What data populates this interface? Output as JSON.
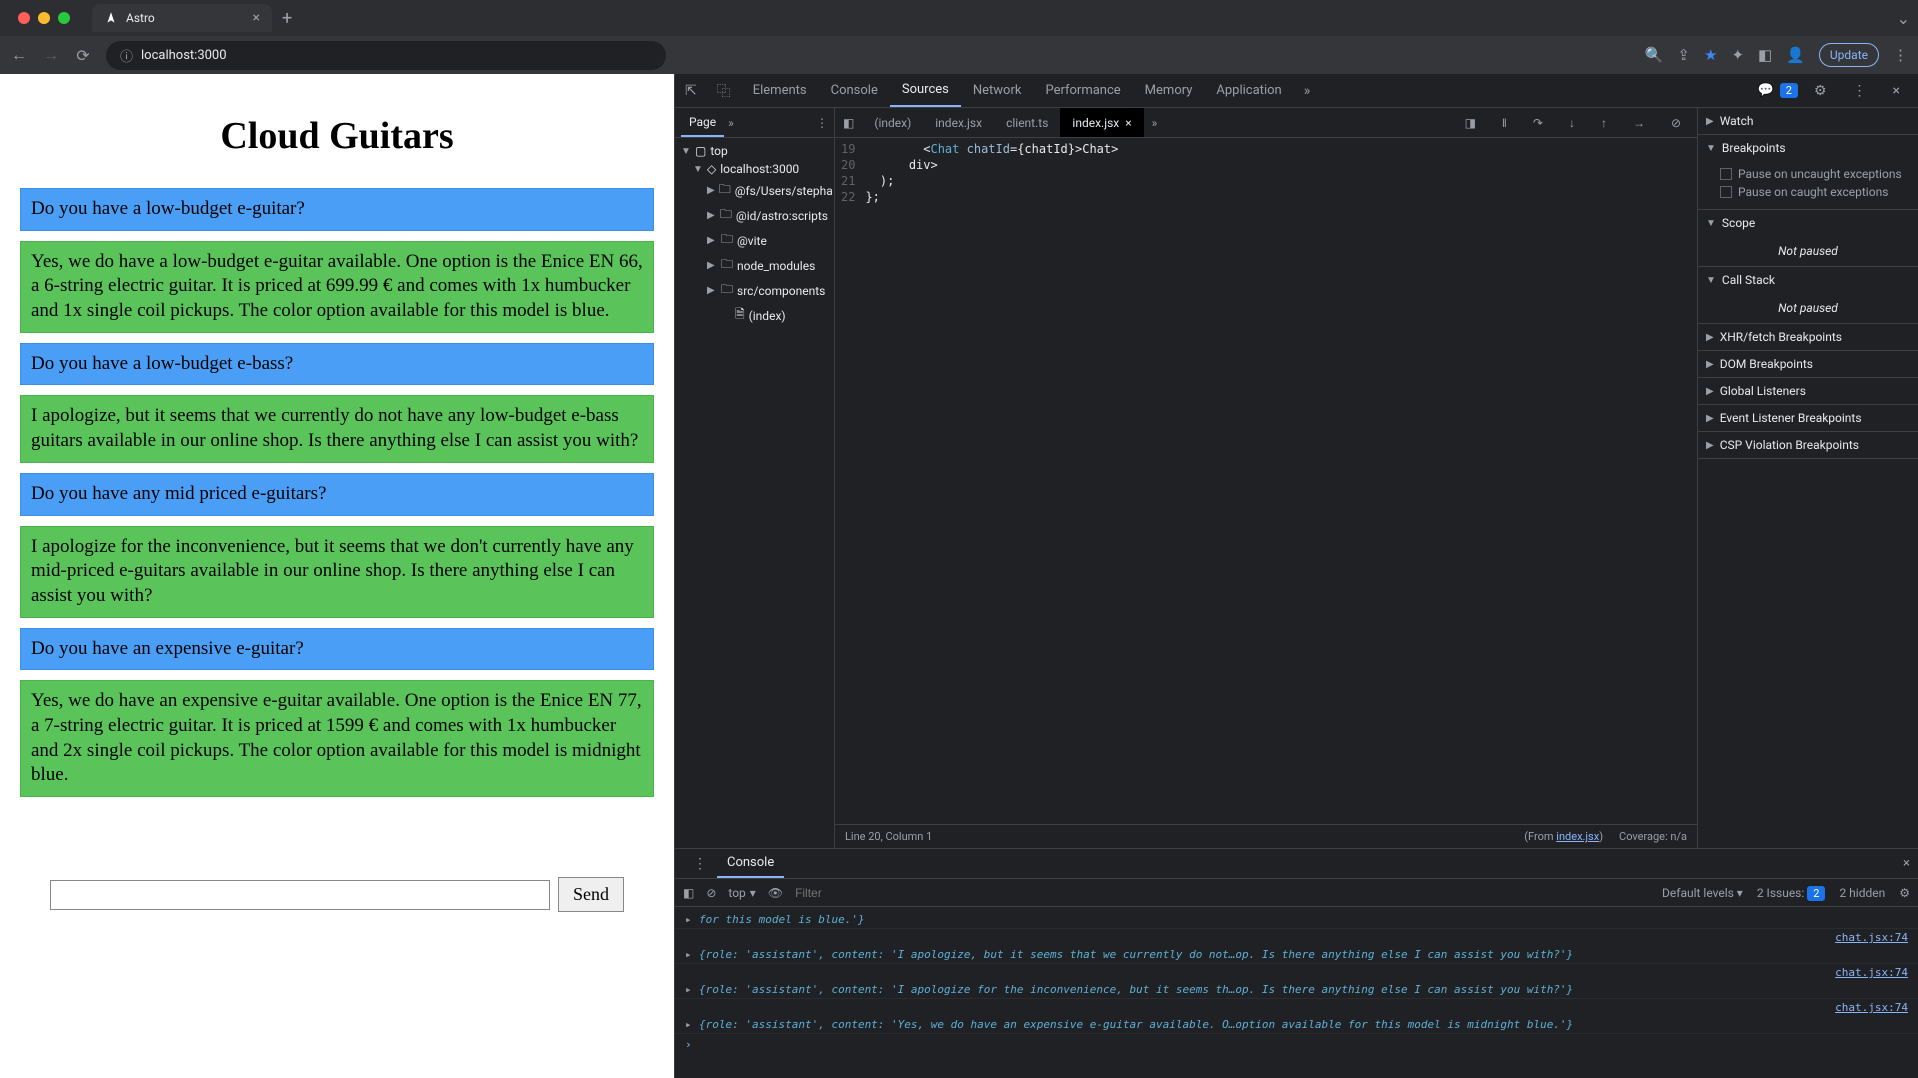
{
  "browser": {
    "tab_title": "Astro",
    "url": "localhost:3000",
    "update_label": "Update"
  },
  "page": {
    "title": "Cloud Guitars",
    "messages": [
      {
        "role": "user",
        "text": "Do you have a low-budget e-guitar?"
      },
      {
        "role": "assistant",
        "text": "Yes, we do have a low-budget e-guitar available. One option is the Enice EN 66, a 6-string electric guitar. It is priced at 699.99 € and comes with 1x humbucker and 1x single coil pickups. The color option available for this model is blue."
      },
      {
        "role": "user",
        "text": "Do you have a low-budget e-bass?"
      },
      {
        "role": "assistant",
        "text": "I apologize, but it seems that we currently do not have any low-budget e-bass guitars available in our online shop. Is there anything else I can assist you with?"
      },
      {
        "role": "user",
        "text": "Do you have any mid priced e-guitars?"
      },
      {
        "role": "assistant",
        "text": "I apologize for the inconvenience, but it seems that we don't currently have any mid-priced e-guitars available in our online shop. Is there anything else I can assist you with?"
      },
      {
        "role": "user",
        "text": "Do you have an expensive e-guitar?"
      },
      {
        "role": "assistant",
        "text": "Yes, we do have an expensive e-guitar available. One option is the Enice EN 77, a 7-string electric guitar. It is priced at 1599 € and comes with 1x humbucker and 2x single coil pickups. The color option available for this model is midnight blue."
      }
    ],
    "send_label": "Send"
  },
  "devtools": {
    "tabs": [
      "Elements",
      "Console",
      "Sources",
      "Network",
      "Performance",
      "Memory",
      "Application"
    ],
    "active_tab": "Sources",
    "issues_count": "2",
    "sources": {
      "nav_tab": "Page",
      "tree": {
        "top": "top",
        "host": "localhost:3000",
        "folders": [
          "@fs/Users/stepha",
          "@id/astro:scripts",
          "@vite",
          "node_modules",
          "src/components"
        ],
        "file": "(index)"
      },
      "open_files": [
        "(index)",
        "index.jsx",
        "client.ts",
        "index.jsx"
      ],
      "active_file_index": 3,
      "code_lines": [
        {
          "n": "19",
          "html": "        <<span class='tok-tag'>Chat</span> <span class='tok-attr'>chatId</span>={chatId}></<span class='tok-tag'>Chat</span>>"
        },
        {
          "n": "20",
          "html": "      </<span class='tok-tag'>div</span>>"
        },
        {
          "n": "21",
          "html": "  );"
        },
        {
          "n": "22",
          "html": "};"
        }
      ],
      "status_left": "Line 20, Column 1",
      "status_from": "(From ",
      "status_from_link": "index.jsx",
      "status_from_suffix": ")",
      "status_coverage": "Coverage: n/a"
    },
    "debugger": {
      "watch": "Watch",
      "breakpoints": "Breakpoints",
      "pause_uncaught": "Pause on uncaught exceptions",
      "pause_caught": "Pause on caught exceptions",
      "scope": "Scope",
      "call_stack": "Call Stack",
      "not_paused": "Not paused",
      "xhr_bp": "XHR/fetch Breakpoints",
      "dom_bp": "DOM Breakpoints",
      "global_listeners": "Global Listeners",
      "event_bp": "Event Listener Breakpoints",
      "csp_bp": "CSP Violation Breakpoints"
    },
    "console": {
      "tab_label": "Console",
      "context": "top",
      "filter_placeholder": "Filter",
      "levels": "Default levels",
      "issues_label": "2 Issues:",
      "issues_badge": "2",
      "hidden": "2 hidden",
      "logs": [
        {
          "text": "for this model is blue.'}",
          "src": ""
        },
        {
          "text": "{role: 'assistant', content: 'I apologize, but it seems that we currently do not…op. Is there anything else I can assist you with?'}",
          "src": "chat.jsx:74"
        },
        {
          "text": "{role: 'assistant', content: 'I apologize for the inconvenience, but it seems th…op. Is there anything else I can assist you with?'}",
          "src": "chat.jsx:74"
        },
        {
          "text": "{role: 'assistant', content: 'Yes, we do have an expensive e-guitar available. O…option available for this model is midnight blue.'}",
          "src": "chat.jsx:74"
        }
      ]
    }
  }
}
